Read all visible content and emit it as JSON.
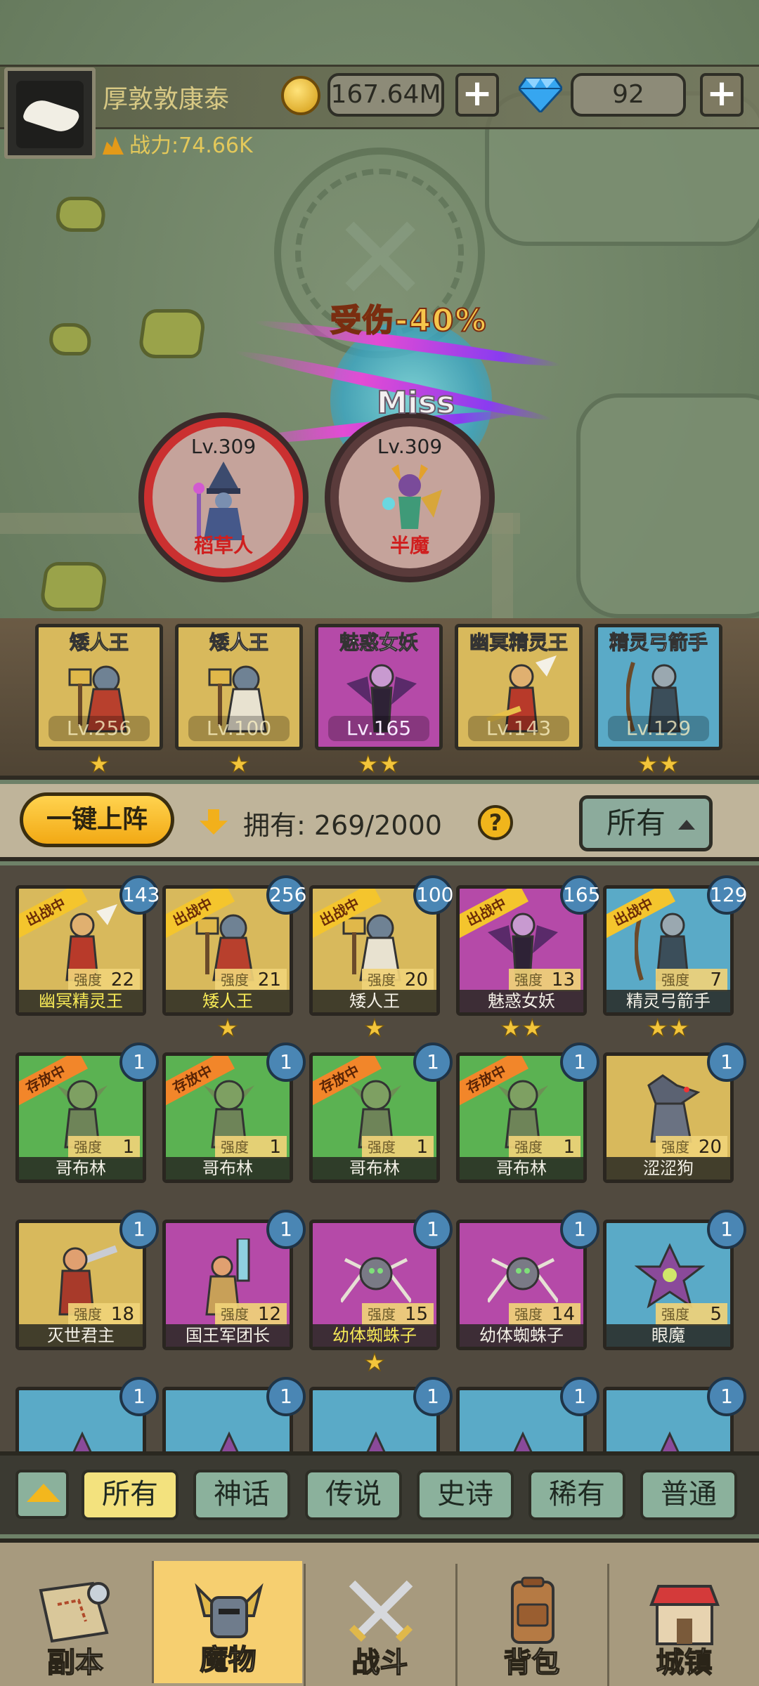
{
  "player": {
    "name": "厚敦敦康泰",
    "power": "战力:74.66K",
    "coins": "167.64M",
    "gems": "92"
  },
  "battle": {
    "damage_text": "受伤-40%",
    "miss_text": "Miss",
    "enemies": [
      {
        "level": "Lv.309",
        "name": "稻草人"
      },
      {
        "level": "Lv.309",
        "name": "半魔"
      }
    ]
  },
  "team": [
    {
      "name": "矮人王",
      "level": "Lv.256",
      "stars": "★"
    },
    {
      "name": "矮人王",
      "level": "Lv.100",
      "stars": "★"
    },
    {
      "name": "魅惑女妖",
      "level": "Lv.165",
      "stars": "★★"
    },
    {
      "name": "幽冥精灵王",
      "level": "Lv.143",
      "stars": ""
    },
    {
      "name": "精灵弓箭手",
      "level": "Lv.129",
      "stars": "★★"
    }
  ],
  "controls": {
    "auto_deploy": "一键上阵",
    "owned": "拥有: 269/2000",
    "help": "?",
    "filter": "所有"
  },
  "monsters": [
    {
      "name": "幽冥精灵王",
      "strength_label": "强度",
      "strength": "22",
      "badge": "143",
      "tag": "出战中",
      "stars": "",
      "highlight": true
    },
    {
      "name": "矮人王",
      "strength_label": "强度",
      "strength": "21",
      "badge": "256",
      "tag": "出战中",
      "stars": "★",
      "highlight": true
    },
    {
      "name": "矮人王",
      "strength_label": "强度",
      "strength": "20",
      "badge": "100",
      "tag": "出战中",
      "stars": "★",
      "highlight": false
    },
    {
      "name": "魅惑女妖",
      "strength_label": "强度",
      "strength": "13",
      "badge": "165",
      "tag": "出战中",
      "stars": "★★",
      "highlight": false
    },
    {
      "name": "精灵弓箭手",
      "strength_label": "强度",
      "strength": "7",
      "badge": "129",
      "tag": "出战中",
      "stars": "★★",
      "highlight": false
    },
    {
      "name": "哥布林",
      "strength_label": "强度",
      "strength": "1",
      "badge": "1",
      "tag": "存放中",
      "stars": "",
      "highlight": false
    },
    {
      "name": "哥布林",
      "strength_label": "强度",
      "strength": "1",
      "badge": "1",
      "tag": "存放中",
      "stars": "",
      "highlight": false
    },
    {
      "name": "哥布林",
      "strength_label": "强度",
      "strength": "1",
      "badge": "1",
      "tag": "存放中",
      "stars": "",
      "highlight": false
    },
    {
      "name": "哥布林",
      "strength_label": "强度",
      "strength": "1",
      "badge": "1",
      "tag": "存放中",
      "stars": "",
      "highlight": false
    },
    {
      "name": "涩涩狗",
      "strength_label": "强度",
      "strength": "20",
      "badge": "1",
      "tag": "",
      "stars": "",
      "highlight": false
    },
    {
      "name": "灭世君主",
      "strength_label": "强度",
      "strength": "18",
      "badge": "1",
      "tag": "",
      "stars": "",
      "highlight": false
    },
    {
      "name": "国王军团长",
      "strength_label": "强度",
      "strength": "12",
      "badge": "1",
      "tag": "",
      "stars": "",
      "highlight": false
    },
    {
      "name": "幼体蜘蛛子",
      "strength_label": "强度",
      "strength": "15",
      "badge": "1",
      "tag": "",
      "stars": "★",
      "highlight": true
    },
    {
      "name": "幼体蜘蛛子",
      "strength_label": "强度",
      "strength": "14",
      "badge": "1",
      "tag": "",
      "stars": "",
      "highlight": false
    },
    {
      "name": "眼魔",
      "strength_label": "强度",
      "strength": "5",
      "badge": "1",
      "tag": "",
      "stars": "",
      "highlight": false
    },
    {
      "badge": "1"
    },
    {
      "badge": "1"
    },
    {
      "badge": "1"
    },
    {
      "badge": "1"
    },
    {
      "badge": "1"
    }
  ],
  "rarity_tabs": [
    "所有",
    "神话",
    "传说",
    "史诗",
    "稀有",
    "普通"
  ],
  "nav": [
    "副本",
    "魔物",
    "战斗",
    "背包",
    "城镇"
  ],
  "colors": {
    "accent": "#f2a914",
    "active_tab": "#f3e27e",
    "tag_fight": "#f4c52d",
    "tag_store": "#f2862a"
  }
}
